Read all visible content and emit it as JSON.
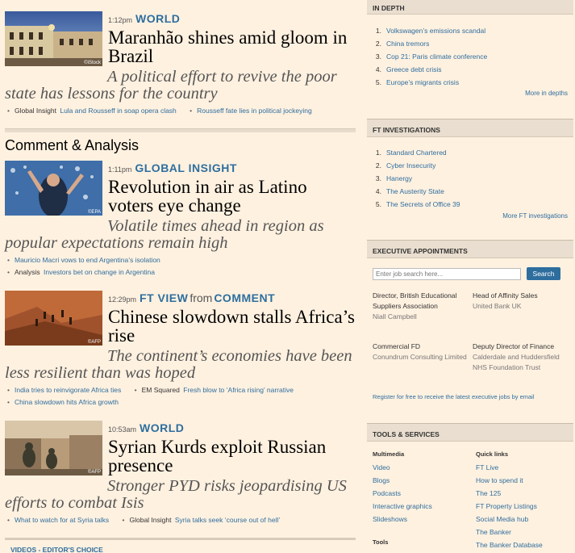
{
  "stories": [
    {
      "time": "1:12pm",
      "section": "WORLD",
      "headline": "Maranhão shines amid gloom in Brazil",
      "standfirst": "A political effort to revive the poor state has lessons for the country",
      "credit": "©iStock",
      "related": [
        {
          "label": "Global Insight",
          "link": "Lula and Rousseff in soap opera clash"
        },
        {
          "label": "",
          "link": "Rousseff fate lies in political jockeying"
        }
      ]
    },
    {
      "time": "1:11pm",
      "section": "GLOBAL INSIGHT",
      "headline": "Revolution in air as Latino voters eye change",
      "standfirst": "Volatile times ahead in region as popular expectations remain high",
      "credit": "©EPA",
      "related": [
        {
          "label": "",
          "link": "Mauricio Macri vows to end Argentina’s isolation"
        },
        {
          "label": "Analysis",
          "link": "Investors bet on change in Argentina"
        }
      ]
    },
    {
      "time": "12:29pm",
      "section": "FT VIEW",
      "from": "from",
      "section2": "COMMENT",
      "headline": "Chinese slowdown stalls Africa’s rise",
      "standfirst": "The continent’s economies have been less resilient than was hoped",
      "credit": "©AFP",
      "related": [
        {
          "label": "",
          "link": "India tries to reinvigorate Africa ties"
        },
        {
          "label": "EM Squared",
          "link": "Fresh blow to ‘Africa rising’ narrative"
        },
        {
          "label": "",
          "link": "China slowdown hits Africa growth"
        }
      ]
    },
    {
      "time": "10:53am",
      "section": "WORLD",
      "headline": "Syrian Kurds exploit Russian presence",
      "standfirst": "Stronger PYD risks jeopardising US efforts to combat Isis",
      "credit": "©AFP",
      "related": [
        {
          "label": "",
          "link": "What to watch for at Syria talks"
        },
        {
          "label": "Global Insight",
          "link": "Syria talks seek ‘course out of hell’"
        }
      ]
    }
  ],
  "comment_section_title": "Comment & Analysis",
  "video_header": "VIDEOS - EDITOR'S CHOICE",
  "in_depth": {
    "title": "IN DEPTH",
    "items": [
      "Volkswagen’s emissions scandal",
      "China tremors",
      "Cop 21: Paris climate conference",
      "Greece debt crisis",
      "Europe’s migrants crisis"
    ],
    "more": "More in depths"
  },
  "investigations": {
    "title": "FT INVESTIGATIONS",
    "items": [
      "Standard Chartered",
      "Cyber Insecurity",
      "Hanergy",
      "The Austerity State",
      "The Secrets of Office 39"
    ],
    "more": "More FT investigations"
  },
  "appointments": {
    "title": "EXECUTIVE APPOINTMENTS",
    "placeholder": "Enter job search here...",
    "search_label": "Search",
    "jobs": [
      {
        "title": "Director, British Educational Suppliers Association",
        "company": "Niall Campbell"
      },
      {
        "title": "Head of Affinity Sales",
        "company": "United Bank UK"
      },
      {
        "title": "Commercial FD",
        "company": "Conundrum Consulting Limited"
      },
      {
        "title": "Deputy Director of Finance",
        "company": "Calderdale and Huddersfield NHS Foundation Trust"
      }
    ],
    "register": "Register for free to receive the latest executive jobs by email"
  },
  "tools": {
    "title": "TOOLS & SERVICES",
    "multimedia_title": "Multimedia",
    "multimedia": [
      "Video",
      "Blogs",
      "Podcasts",
      "Interactive graphics",
      "Slideshows"
    ],
    "quicklinks_title": "Quick links",
    "quicklinks": [
      "FT Live",
      "How to spend it",
      "The 125",
      "FT Property Listings",
      "Social Media hub",
      "The Banker",
      "The Banker Database"
    ],
    "tools_title": "Tools"
  }
}
